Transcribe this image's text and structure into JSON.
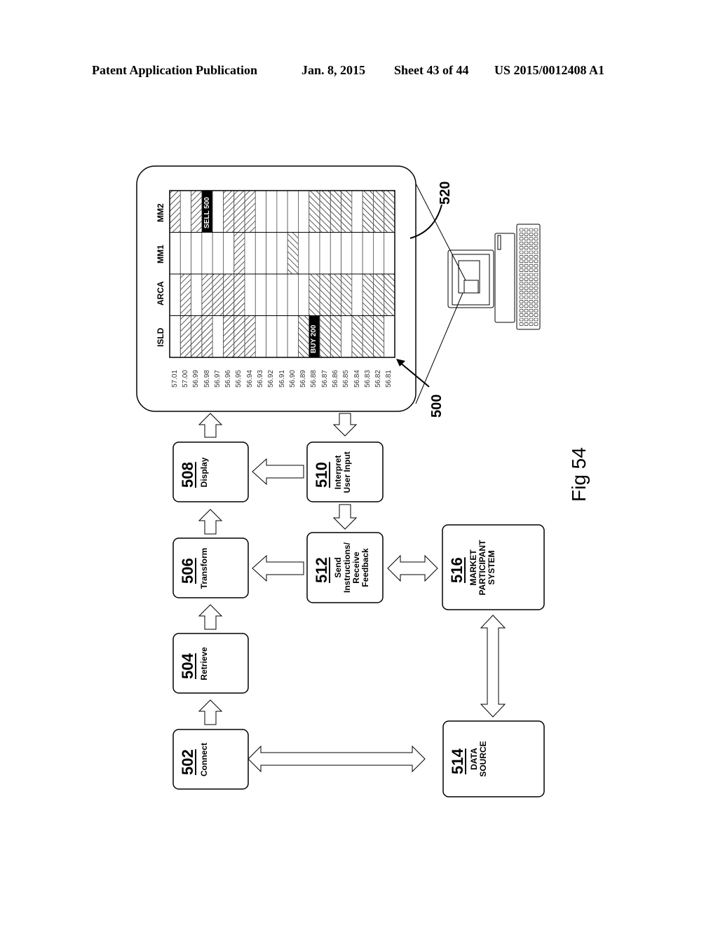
{
  "header": {
    "publication": "Patent Application Publication",
    "date": "Jan. 8, 2015",
    "sheet": "Sheet 43 of 44",
    "patent_number": "US 2015/0012408 A1"
  },
  "figure": {
    "label": "Fig 54",
    "screen_ref": "500",
    "computer_ref": "520"
  },
  "ladder": {
    "brokers": [
      "MM2",
      "MM1",
      "ARCA",
      "ISLD"
    ],
    "prices": [
      "57.01",
      "57.00",
      "56.99",
      "56.98",
      "56.97",
      "56.96",
      "56.95",
      "56.94",
      "56.93",
      "56.92",
      "56.91",
      "56.90",
      "56.89",
      "56.88",
      "56.87",
      "56.86",
      "56.85",
      "56.84",
      "56.83",
      "56.82",
      "56.81"
    ],
    "cells": {
      "MM2": {
        "ask": [
          0,
          2,
          5,
          6,
          7
        ],
        "bid": [
          13,
          14,
          15,
          16,
          18,
          19,
          20
        ],
        "order": {
          "index": 3,
          "label": "SELL 500"
        }
      },
      "MM1": {
        "ask": [
          6
        ],
        "bid": [
          11
        ],
        "order": null
      },
      "ARCA": {
        "ask": [
          1,
          3,
          4,
          5,
          6
        ],
        "bid": [
          13,
          14,
          15,
          16,
          18,
          19,
          20
        ],
        "order": null
      },
      "ISLD": {
        "ask": [
          1,
          2,
          3,
          5,
          6,
          7
        ],
        "bid": [
          12,
          14,
          15,
          17,
          18,
          19
        ],
        "order": {
          "index": 13,
          "label": "BUY 200"
        }
      }
    }
  },
  "boxes": [
    {
      "id": "502",
      "label": "Connect"
    },
    {
      "id": "504",
      "label": "Retrieve"
    },
    {
      "id": "506",
      "label": "Transform"
    },
    {
      "id": "508",
      "label": "Display"
    },
    {
      "id": "510",
      "label": "Interpret\nUser Input"
    },
    {
      "id": "512",
      "label": "Send\nInstructions/\nReceive\nFeedback"
    },
    {
      "id": "514",
      "label": "DATA\nSOURCE"
    },
    {
      "id": "516",
      "label": "MARKET\nPARTICIPANT\nSYSTEM"
    }
  ]
}
